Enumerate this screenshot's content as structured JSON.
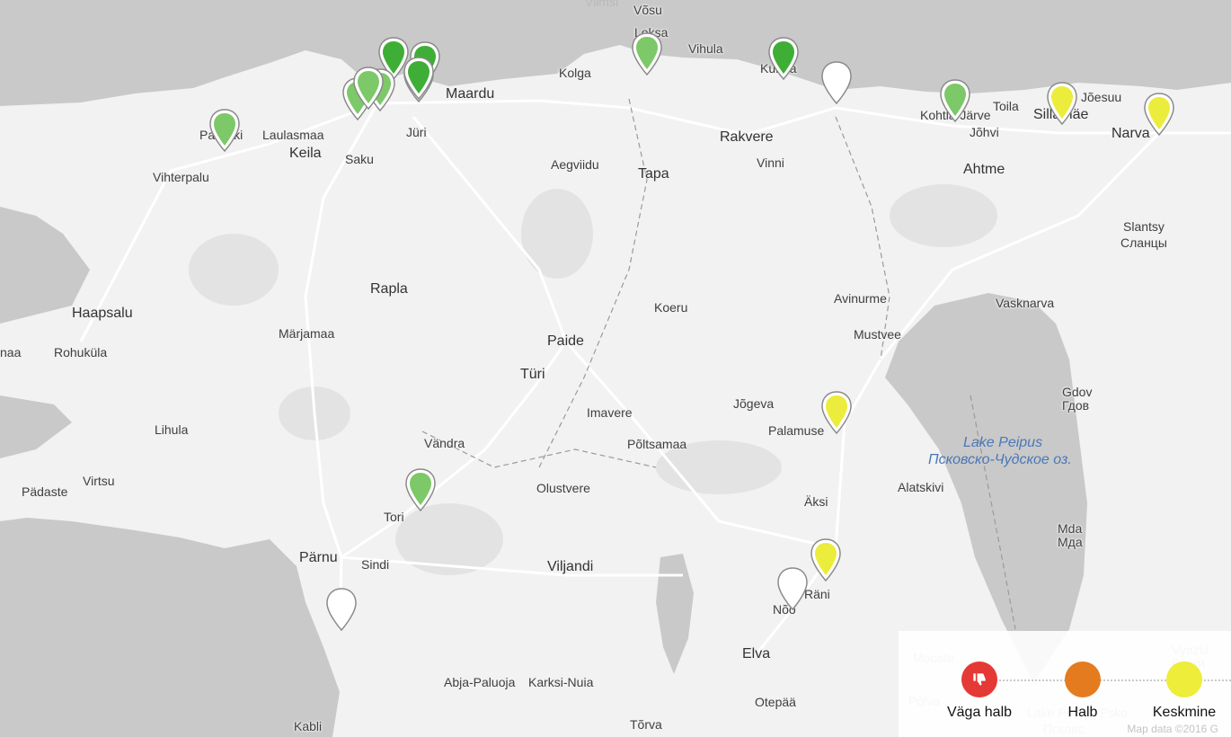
{
  "places": [
    {
      "name": "Viimsi",
      "cls": "faint"
    },
    {
      "name": "Võsu",
      "cls": ""
    },
    {
      "name": "Loksa",
      "cls": ""
    },
    {
      "name": "Vihula",
      "cls": ""
    },
    {
      "name": "Kolga",
      "cls": ""
    },
    {
      "name": "Maardu",
      "cls": "big"
    },
    {
      "name": "Kunda",
      "cls": ""
    },
    {
      "name": "Toila",
      "cls": ""
    },
    {
      "name": "Jõesuu",
      "cls": ""
    },
    {
      "name": "Kohtla-Järve",
      "cls": ""
    },
    {
      "name": "Sillamäe",
      "cls": "big"
    },
    {
      "name": "Narva",
      "cls": "big"
    },
    {
      "name": "Paldiski",
      "cls": ""
    },
    {
      "name": "Laulasmaa",
      "cls": ""
    },
    {
      "name": "Keila",
      "cls": "big"
    },
    {
      "name": "Saku",
      "cls": ""
    },
    {
      "name": "Jüri",
      "cls": ""
    },
    {
      "name": "Aegviidu",
      "cls": ""
    },
    {
      "name": "Tapa",
      "cls": "big"
    },
    {
      "name": "Rakvere",
      "cls": "big"
    },
    {
      "name": "Vinni",
      "cls": ""
    },
    {
      "name": "Jõhvi",
      "cls": ""
    },
    {
      "name": "Ahtme",
      "cls": "big"
    },
    {
      "name": "Vihterpalu",
      "cls": ""
    },
    {
      "name": "Slantsy",
      "cls": ""
    },
    {
      "name": "Сланцы",
      "cls": ""
    },
    {
      "name": "Rapla",
      "cls": "big"
    },
    {
      "name": "Avinurme",
      "cls": ""
    },
    {
      "name": "Vasknarva",
      "cls": ""
    },
    {
      "name": "Haapsalu",
      "cls": "big"
    },
    {
      "name": "Koeru",
      "cls": ""
    },
    {
      "name": "Märjamaa",
      "cls": ""
    },
    {
      "name": "Paide",
      "cls": "big"
    },
    {
      "name": "Rohuküla",
      "cls": ""
    },
    {
      "name": "naa",
      "cls": ""
    },
    {
      "name": "Mustvee",
      "cls": ""
    },
    {
      "name": "Türi",
      "cls": "big"
    },
    {
      "name": "Gdov",
      "cls": ""
    },
    {
      "name": "Гдов",
      "cls": ""
    },
    {
      "name": "Jõgeva",
      "cls": ""
    },
    {
      "name": "Imavere",
      "cls": ""
    },
    {
      "name": "Lihula",
      "cls": ""
    },
    {
      "name": "Palamuse",
      "cls": ""
    },
    {
      "name": "Põltsamaa",
      "cls": ""
    },
    {
      "name": "Vändra",
      "cls": ""
    },
    {
      "name": "Lake Peipus",
      "cls": "water"
    },
    {
      "name": "Псковско-Чудское оз.",
      "cls": "water"
    },
    {
      "name": "Virtsu",
      "cls": ""
    },
    {
      "name": "Pädaste",
      "cls": ""
    },
    {
      "name": "Olustvere",
      "cls": ""
    },
    {
      "name": "Alatskivi",
      "cls": ""
    },
    {
      "name": "Äksi",
      "cls": ""
    },
    {
      "name": "Tori",
      "cls": ""
    },
    {
      "name": "Mda",
      "cls": ""
    },
    {
      "name": "Мда",
      "cls": ""
    },
    {
      "name": "Pärnu",
      "cls": "big"
    },
    {
      "name": "Sindi",
      "cls": ""
    },
    {
      "name": "Viljandi",
      "cls": "big"
    },
    {
      "name": "Nõo",
      "cls": ""
    },
    {
      "name": "Räni",
      "cls": ""
    },
    {
      "name": "Elva",
      "cls": "big"
    },
    {
      "name": "Abja-Paluoja",
      "cls": ""
    },
    {
      "name": "Karksi-Nuia",
      "cls": ""
    },
    {
      "name": "Otepää",
      "cls": ""
    },
    {
      "name": "Kabli",
      "cls": ""
    },
    {
      "name": "Tõrva",
      "cls": ""
    },
    {
      "name": "Mooste",
      "cls": "faint"
    },
    {
      "name": "Põlva",
      "cls": "faint"
    },
    {
      "name": "Vyazki",
      "cls": "faint"
    },
    {
      "name": "Вязки",
      "cls": "faint"
    },
    {
      "name": "Lake Peipus/Psko",
      "cls": "faint"
    },
    {
      "name": "Псковс",
      "cls": "faint"
    }
  ],
  "colors": {
    "land": "#f2f2f2",
    "water": "#c9c9c9",
    "forest": "#dedede",
    "road": "#ffffff",
    "green_light": "#7dc868",
    "green_dark": "#3fae36",
    "yellow": "#ecec3c",
    "white": "#ffffff",
    "legend_red": "#e53935",
    "legend_orange": "#e57b1f",
    "legend_yellow": "#eded3a"
  },
  "markers": [
    {
      "status": "good"
    },
    {
      "status": "good"
    },
    {
      "status": "very-good"
    },
    {
      "status": "good"
    },
    {
      "status": "very-good"
    },
    {
      "status": "very-good"
    },
    {
      "status": "very-good"
    },
    {
      "status": "good"
    },
    {
      "status": "good"
    },
    {
      "status": "very-good"
    },
    {
      "status": "no-data"
    },
    {
      "status": "good"
    },
    {
      "status": "moderate"
    },
    {
      "status": "moderate"
    },
    {
      "status": "moderate"
    },
    {
      "status": "good"
    },
    {
      "status": "moderate"
    },
    {
      "status": "no-data"
    },
    {
      "status": "no-data"
    }
  ],
  "legend": {
    "items": [
      {
        "label": "Väga halb",
        "color": "#e53935",
        "icon": "thumbs-down-icon"
      },
      {
        "label": "Halb",
        "color": "#e57b1f",
        "icon": ""
      },
      {
        "label": "Keskmine",
        "color": "#eded3a",
        "icon": ""
      }
    ]
  },
  "attribution": "Map data ©2016 G"
}
